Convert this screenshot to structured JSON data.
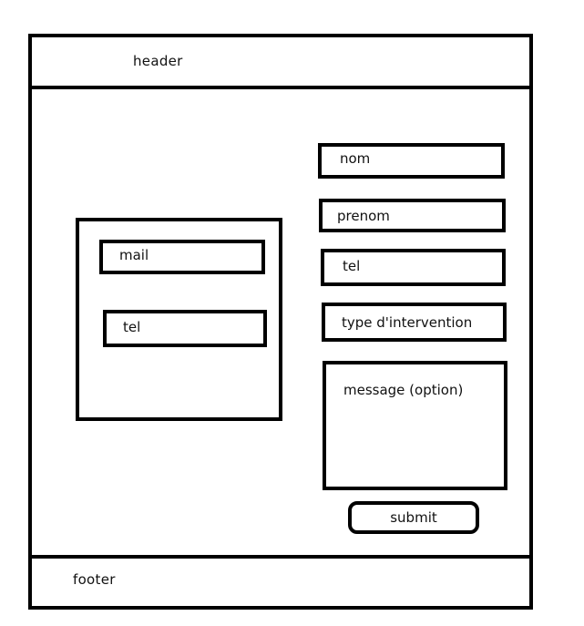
{
  "header": {
    "label": "header"
  },
  "footer": {
    "label": "footer"
  },
  "contact_panel": {
    "mail_label": "mail",
    "tel_label": "tel"
  },
  "form": {
    "nom_label": "nom",
    "prenom_label": "prenom",
    "tel_label": "tel",
    "type_label": "type d'intervention",
    "message_label": "message (option)",
    "submit_label": "submit"
  }
}
